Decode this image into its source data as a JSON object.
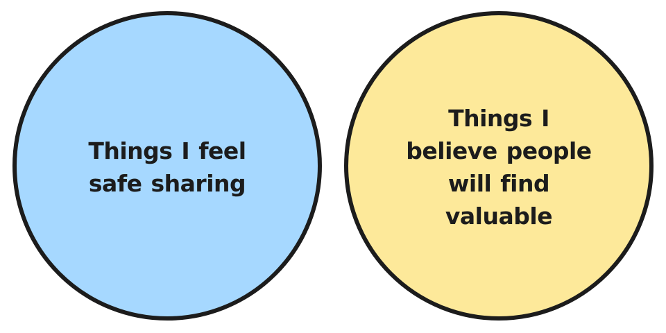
{
  "diagram": {
    "left_circle": {
      "label": "Things I feel safe sharing",
      "fill_color": "#a6d8ff"
    },
    "right_circle": {
      "label": "Things I believe people will find valuable",
      "fill_color": "#fde99a"
    },
    "outline_color": "#1c1c1c"
  }
}
